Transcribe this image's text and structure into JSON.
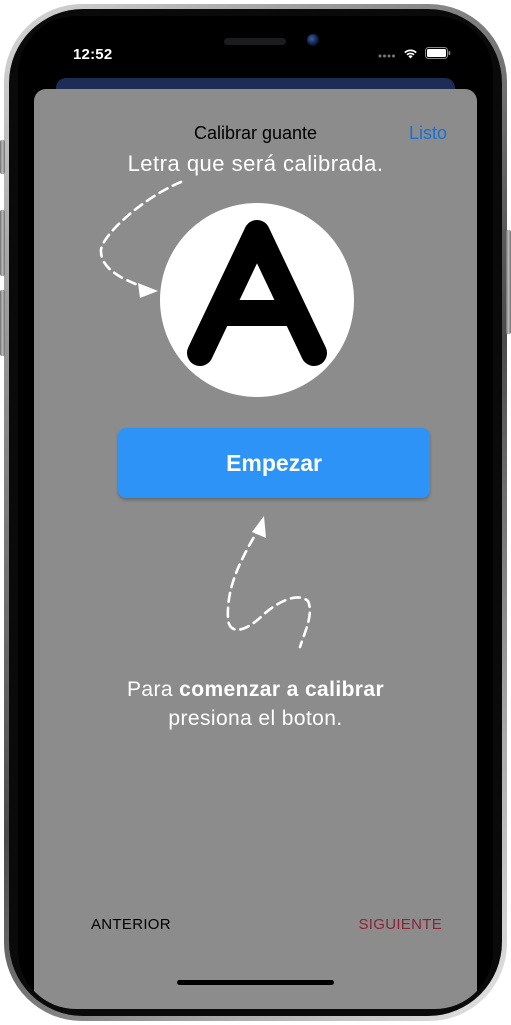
{
  "status_bar": {
    "time": "12:52"
  },
  "header": {
    "title": "Calibrar guante",
    "done_label": "Listo"
  },
  "subtitle": "Letra que será calibrada.",
  "letter": {
    "value": "A"
  },
  "start_button": {
    "label": "Empezar"
  },
  "instruction": {
    "prefix": "Para ",
    "bold": "comenzar a calibrar",
    "line2": "presiona el boton."
  },
  "footer": {
    "prev_label": "ANTERIOR",
    "next_label": "SIGUIENTE"
  },
  "colors": {
    "sheet_background": "#8c8c8c",
    "accent_blue": "#2e93f7",
    "link_blue": "#1a6fd6",
    "next_red": "#8b2335"
  }
}
